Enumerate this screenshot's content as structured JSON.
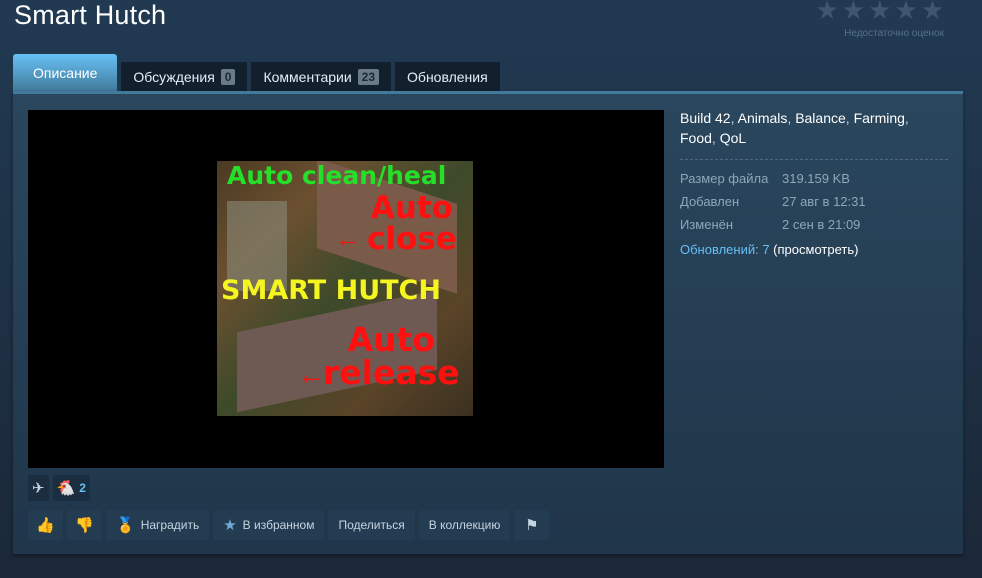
{
  "page": {
    "title": "Smart Hutch",
    "rating_text": "Недостаточно оценок"
  },
  "tabs": [
    {
      "label": "Описание",
      "count": ""
    },
    {
      "label": "Обсуждения",
      "count": "0"
    },
    {
      "label": "Комментарии",
      "count": "23"
    },
    {
      "label": "Обновления",
      "count": ""
    }
  ],
  "preview": {
    "line1": "Auto clean/heal",
    "line2a": "Auto",
    "line2b": "close",
    "line3": "SMART HUTCH",
    "line4a": "Auto",
    "line4b": "release",
    "arrow": "←"
  },
  "tags": [
    "Build 42",
    "Animals",
    "Balance",
    "Farming",
    "Food",
    "QoL"
  ],
  "tag_separator": ",",
  "stats": [
    {
      "label": "Размер файла",
      "value": "319.159 KB"
    },
    {
      "label": "Добавлен",
      "value": "27 авг в 12:31"
    },
    {
      "label": "Изменён",
      "value": "2 сен в 21:09"
    }
  ],
  "updates": {
    "link": "Обновлений: 7",
    "action": "(просмотреть)"
  },
  "awards": [
    {
      "icon": "winged-award-icon",
      "glyph": "✈",
      "count": ""
    },
    {
      "icon": "chicken-award-icon",
      "glyph": "🐔",
      "count": "2"
    }
  ],
  "actions": {
    "award": "Наградить",
    "favorite": "В избранном",
    "share": "Поделиться",
    "collection": "В коллекцию"
  },
  "colors": {
    "accent": "#67c1f5",
    "background": "#1b2838",
    "link": "#66c0f4"
  }
}
